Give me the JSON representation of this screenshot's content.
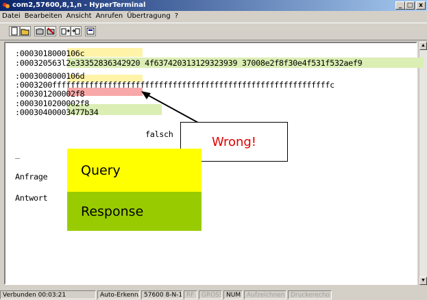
{
  "window": {
    "title": "com2,57600,8,1,n - HyperTerminal",
    "buttons": {
      "minimize": "_",
      "maximize": "□",
      "close": "x"
    }
  },
  "menu": [
    "Datei",
    "Bearbeiten",
    "Ansicht",
    "Anrufen",
    "Übertragung",
    "?"
  ],
  "terminal": {
    "lines": [
      ":0003018000106c",
      ":000320563l2e33352836342920 4f637420313129323939 37008e2f8f30e4f531f532aef9",
      ":0003008000106d",
      ":0003200ffffffffffffffffffffffffffffffffffffffffffffffffffffffffffffc",
      ":000301200002f8",
      ":0003010200002f8",
      ":00030400003477b34"
    ],
    "falsch": "falsch",
    "cursor": "_",
    "anfrage": "Anfrage",
    "antwort": "Antwort"
  },
  "annotations": {
    "wrong": "Wrong!",
    "query": "Query",
    "response": "Response"
  },
  "colors": {
    "yellow_highlight": "#fff3a8",
    "green_highlight": "#dbeeb4",
    "red_highlight": "#f8a8a8",
    "query_box": "#ffff00",
    "response_box": "#99cc00",
    "wrong_text": "#e00000"
  },
  "status": {
    "connected": "Verbunden 00:03:21",
    "auto": "Auto-Erkenn.",
    "settings": "57600 8-N-1",
    "rf": "RF",
    "gross": "GROSS",
    "num": "NUM",
    "aufzeichnen": "Aufzeichnen",
    "druckerecho": "Druckerecho"
  }
}
